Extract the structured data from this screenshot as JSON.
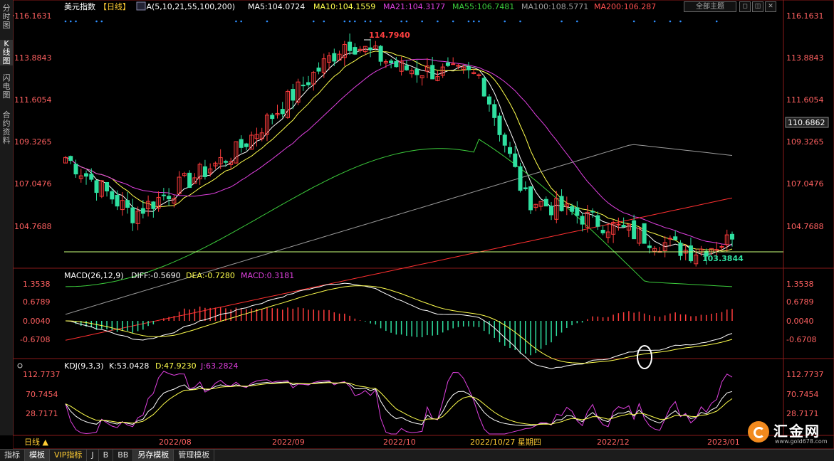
{
  "side_tabs": [
    {
      "label": "分时图",
      "active": false
    },
    {
      "label": "K线图",
      "active": true
    },
    {
      "label": "闪电图",
      "active": false
    },
    {
      "label": "合约资料",
      "active": false
    }
  ],
  "header": {
    "instrument": "美元指数",
    "period_tag": "【日线】",
    "ma_title": "MA(5,10,21,55,100,200)",
    "ma5": "MA5:104.0724",
    "ma10": "MA10:104.1559",
    "ma21": "MA21:104.3177",
    "ma55": "MA55:106.7481",
    "ma100": "MA100:108.5771",
    "ma200": "MA200:106.287",
    "theme_button": "全部主题",
    "buttons": [
      "◻",
      "◫",
      "✕"
    ]
  },
  "colors": {
    "up": "#ff3c3c",
    "down": "#2fe0a0",
    "ma5": "#ffffff",
    "ma10": "#ffff4d",
    "ma21": "#e040e0",
    "ma55": "#3ccd3c",
    "ma100": "#9c9c9c",
    "ma200": "#ff3030"
  },
  "price_axis": {
    "left_labels": [
      "116.1631",
      "113.8843",
      "111.6054",
      "109.3265",
      "107.0476",
      "104.7688"
    ],
    "right_labels": [
      "116.1631",
      "113.8843",
      "111.6054",
      "109.3265",
      "107.0476",
      "104.7688"
    ],
    "current_price": "110.6862",
    "high_label": "114.7940",
    "low_label": "103.3844"
  },
  "macd": {
    "title": "MACD(26,12,9)",
    "diff": "DIFF:-0.5690",
    "dea": "DEA:-0.7280",
    "macd": "MACD:0.3181",
    "labels": [
      "1.3538",
      "0.6789",
      "0.0040",
      "-0.6708"
    ]
  },
  "kdj": {
    "title": "KDJ(9,3,3)",
    "k": "K:53.0428",
    "d": "D:47.9230",
    "j": "J:63.2824",
    "labels": [
      "112.7737",
      "70.7454",
      "28.7171"
    ]
  },
  "time_axis": {
    "period": "日线 ▲",
    "labels": [
      "2022/08",
      "2022/09",
      "2022/10",
      "2022/10/27 星期四",
      "2022/12",
      "2023/01"
    ]
  },
  "bottom_tabs": [
    {
      "label": "指标",
      "active": false
    },
    {
      "label": "模板",
      "active": true
    },
    {
      "label": "VIP指标",
      "active": false
    },
    {
      "label": "J",
      "active": false
    },
    {
      "label": "B",
      "active": false
    },
    {
      "label": "BB",
      "active": false
    },
    {
      "label": "另存模板",
      "active": true
    },
    {
      "label": "管理模板",
      "active": false
    }
  ],
  "brand": {
    "name": "汇金网",
    "url": "www.gold678.com"
  },
  "chart_data": {
    "type": "candlestick",
    "title": "美元指数 日线",
    "ylim": [
      102.0,
      116.6
    ],
    "x_range": [
      "2022-07",
      "2023-01"
    ],
    "high": 114.794,
    "low": 103.3844,
    "last_close": 104.07,
    "key_points": [
      {
        "date": "2022-07-14",
        "close": 108.5
      },
      {
        "date": "2022-08-01",
        "close": 105.4
      },
      {
        "date": "2022-08-29",
        "close": 108.8
      },
      {
        "date": "2022-09-28",
        "close": 114.79
      },
      {
        "date": "2022-10-13",
        "close": 113.3
      },
      {
        "date": "2022-11-03",
        "close": 112.9
      },
      {
        "date": "2022-11-15",
        "close": 106.3
      },
      {
        "date": "2022-12-30",
        "close": 103.38
      },
      {
        "date": "2023-01-10",
        "close": 104.07
      }
    ],
    "series": [
      {
        "name": "MA5",
        "last": 104.0724
      },
      {
        "name": "MA10",
        "last": 104.1559
      },
      {
        "name": "MA21",
        "last": 104.3177
      },
      {
        "name": "MA55",
        "last": 106.7481
      },
      {
        "name": "MA100",
        "last": 108.5771
      },
      {
        "name": "MA200",
        "last": 106.287
      }
    ],
    "macd_last": {
      "diff": -0.569,
      "dea": -0.728,
      "macd": 0.3181
    },
    "kdj_last": {
      "k": 53.0428,
      "d": 47.923,
      "j": 63.2824
    }
  }
}
